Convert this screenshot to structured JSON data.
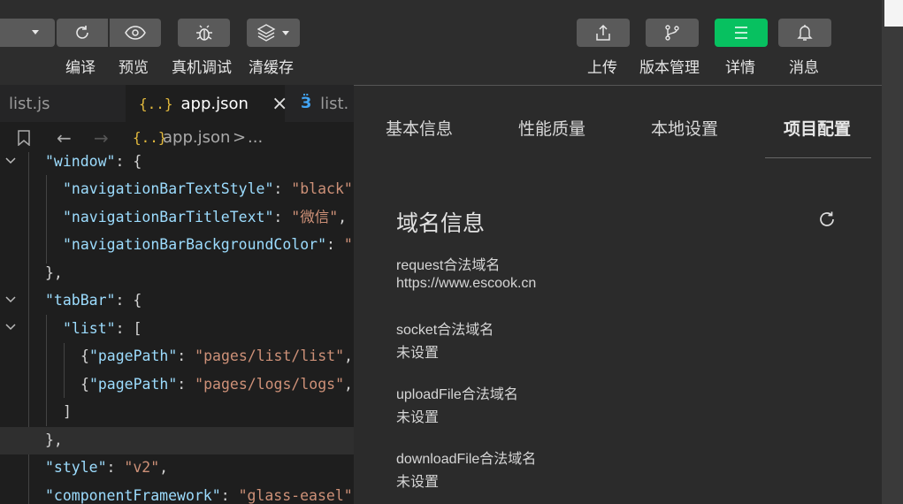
{
  "toolbar": {
    "left_buttons": [
      {
        "label": "编译"
      },
      {
        "label": "预览"
      },
      {
        "label": "真机调试"
      },
      {
        "label": "清缓存"
      }
    ],
    "right_buttons": [
      {
        "label": "上传"
      },
      {
        "label": "版本管理"
      },
      {
        "label": "详情"
      },
      {
        "label": "消息"
      }
    ],
    "accent": "#07c160"
  },
  "editor": {
    "tabs": [
      {
        "label": "list.js"
      },
      {
        "label": "app.json",
        "icon": "{..}"
      },
      {
        "label": "list."
      }
    ],
    "breadcrumb": {
      "icon": "{..}",
      "file": "app.json",
      "sep": ">",
      "more": "..."
    },
    "code": [
      "\"window\": {",
      "\"navigationBarTextStyle\": \"black\"",
      "\"navigationBarTitleText\": \"微信\",",
      "\"navigationBarBackgroundColor\": \"",
      "},",
      "\"tabBar\": {",
      "\"list\": [",
      "{\"pagePath\": \"pages/list/list\",",
      "{\"pagePath\": \"pages/logs/logs\",",
      "]",
      "},",
      "\"style\": \"v2\",",
      "\"componentFramework\": \"glass-easel\""
    ]
  },
  "panel": {
    "tabs": [
      {
        "label": "基本信息"
      },
      {
        "label": "性能质量"
      },
      {
        "label": "本地设置"
      },
      {
        "label": "项目配置"
      }
    ],
    "section_title": "域名信息",
    "domains": [
      {
        "label": "request合法域名",
        "value": "https://www.escook.cn"
      },
      {
        "label": "socket合法域名",
        "value": "未设置"
      },
      {
        "label": "uploadFile合法域名",
        "value": "未设置"
      },
      {
        "label": "downloadFile合法域名",
        "value": "未设置"
      }
    ]
  }
}
